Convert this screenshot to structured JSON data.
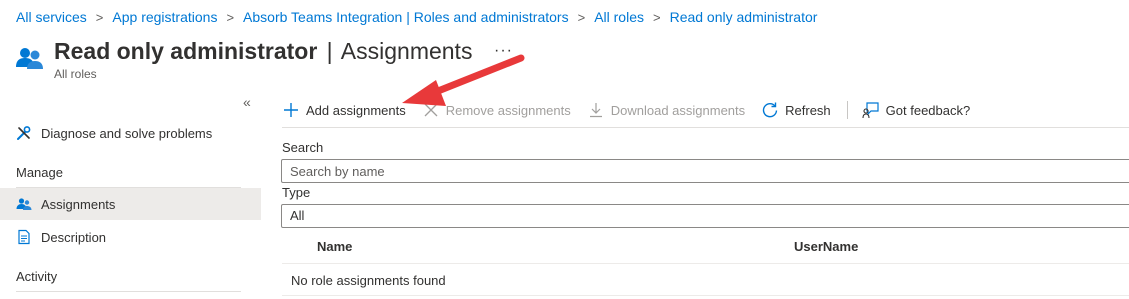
{
  "breadcrumb": {
    "items": [
      "All services",
      "App registrations",
      "Absorb Teams Integration | Roles and administrators",
      "All roles",
      "Read only administrator"
    ],
    "separator": ">"
  },
  "header": {
    "title_strong": "Read only administrator",
    "title_divider": "|",
    "title_light": "Assignments",
    "subtitle": "All roles",
    "more": "···"
  },
  "sidebar": {
    "collapse": "«",
    "diagnose_label": "Diagnose and solve problems",
    "manage_section": "Manage",
    "assignments_label": "Assignments",
    "description_label": "Description",
    "activity_section": "Activity"
  },
  "toolbar": {
    "add_label": "Add assignments",
    "remove_label": "Remove assignments",
    "download_label": "Download assignments",
    "refresh_label": "Refresh",
    "feedback_label": "Got feedback?"
  },
  "filters": {
    "search_label": "Search",
    "search_placeholder": "Search by name",
    "type_label": "Type",
    "type_value": "All"
  },
  "table": {
    "columns": [
      "Name",
      "UserName"
    ],
    "empty_message": "No role assignments found"
  },
  "colors": {
    "link": "#0078d4",
    "arrow": "#e8393a",
    "active_bg": "#edebe9"
  }
}
